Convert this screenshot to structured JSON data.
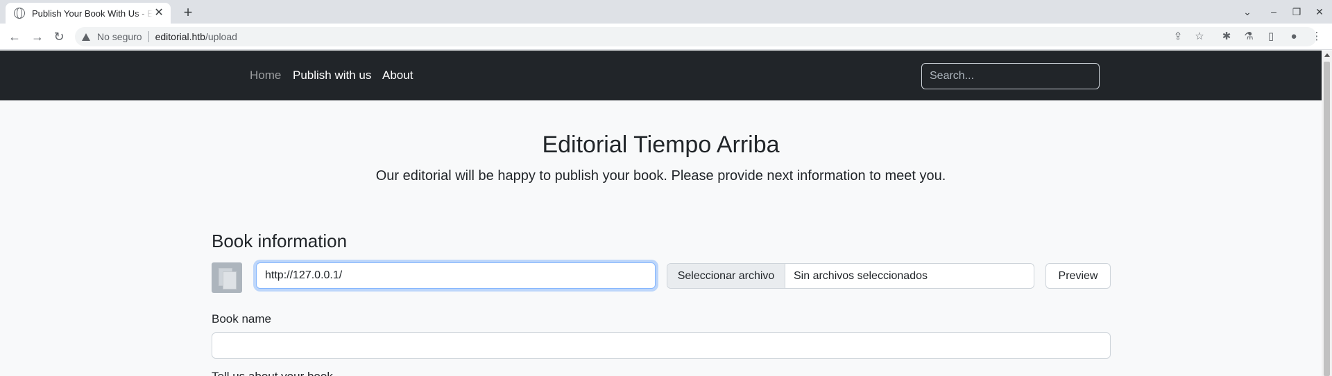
{
  "browser": {
    "tab_title": "Publish Your Book With Us - Editorial",
    "tab_close": "✕",
    "new_tab": "+",
    "window_controls": [
      "⌄",
      "–",
      "❐",
      "✕"
    ],
    "security_label": "No seguro",
    "url_host": "editorial.htb",
    "url_path": "/upload",
    "nav": {
      "back": "←",
      "forward": "→",
      "reload": "↻"
    },
    "toolbar_icons": {
      "share": "⇪",
      "star": "☆",
      "extensions": "✱",
      "labs": "⚗",
      "sidepanel": "▯",
      "profile": "●",
      "menu": "⋮"
    }
  },
  "site": {
    "nav": {
      "items": [
        {
          "label": "Home",
          "active": false
        },
        {
          "label": "Publish with us",
          "active": true
        },
        {
          "label": "About",
          "active": true
        }
      ],
      "search_placeholder": "Search..."
    },
    "hero": {
      "title": "Editorial Tiempo Arriba",
      "subtitle": "Our editorial will be happy to publish your book. Please provide next information to meet you."
    },
    "form": {
      "section_title": "Book information",
      "cover_url_value": "http://127.0.0.1/",
      "file_button": "Seleccionar archivo",
      "file_status": "Sin archivos seleccionados",
      "preview_button": "Preview",
      "book_name_label": "Book name",
      "book_name_value": "",
      "next_label": "Tell us about your book"
    }
  }
}
